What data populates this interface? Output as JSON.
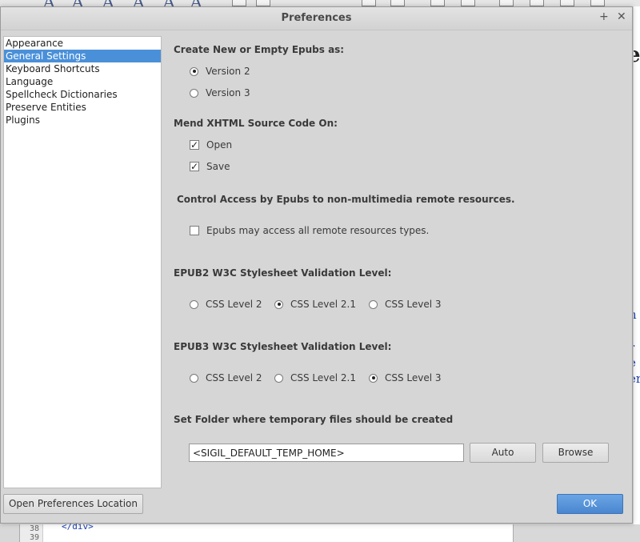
{
  "dialog": {
    "title": "Preferences",
    "maximize_glyph": "+",
    "close_glyph": "✕"
  },
  "sidebar": {
    "items": [
      {
        "label": "Appearance",
        "selected": false
      },
      {
        "label": "General Settings",
        "selected": true
      },
      {
        "label": "Keyboard Shortcuts",
        "selected": false
      },
      {
        "label": "Language",
        "selected": false
      },
      {
        "label": "Spellcheck Dictionaries",
        "selected": false
      },
      {
        "label": "Preserve Entities",
        "selected": false
      },
      {
        "label": "Plugins",
        "selected": false
      }
    ]
  },
  "general": {
    "epub_version": {
      "heading": "Create New or Empty Epubs as:",
      "options": [
        "Version 2",
        "Version 3"
      ],
      "selected": "Version 2"
    },
    "mend": {
      "heading": "Mend XHTML Source Code On:",
      "open_label": "Open",
      "open_checked": true,
      "save_label": "Save",
      "save_checked": true
    },
    "remote": {
      "heading": "Control Access by Epubs to non-multimedia remote resources.",
      "checkbox_label": "Epubs may access all remote resources types.",
      "checked": false
    },
    "epub2_css": {
      "heading": "EPUB2 W3C Stylesheet Validation Level:",
      "options": [
        "CSS Level 2",
        "CSS Level 2.1",
        "CSS Level 3"
      ],
      "selected": "CSS Level 2.1"
    },
    "epub3_css": {
      "heading": "EPUB3 W3C Stylesheet Validation Level:",
      "options": [
        "CSS Level 2",
        "CSS Level 2.1",
        "CSS Level 3"
      ],
      "selected": "CSS Level 3"
    },
    "temp_folder": {
      "heading": "Set Folder where temporary files should be created",
      "value": "<SIGIL_DEFAULT_TEMP_HOME>",
      "auto_label": "Auto",
      "browse_label": "Browse"
    }
  },
  "footer": {
    "open_location_label": "Open Preferences Location",
    "ok_label": "OK"
  },
  "background": {
    "gutter_numbers": [
      "38",
      "39"
    ],
    "code_fragment": "</div>",
    "right_fragments": [
      "e",
      "n",
      "r",
      "e",
      "er"
    ]
  },
  "colors": {
    "selection": "#4a90d9",
    "primary_button": "#4a86cf",
    "link_text": "#1a3fb0"
  }
}
